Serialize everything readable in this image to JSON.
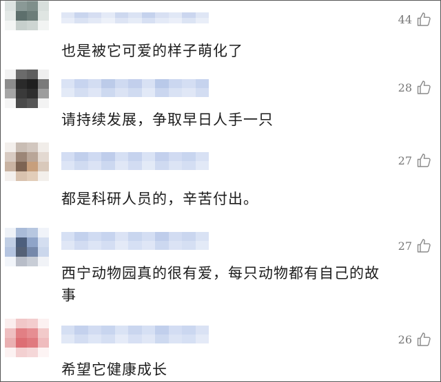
{
  "comments": [
    {
      "likes": "44",
      "text": "也是被它可爱的样子萌化了"
    },
    {
      "likes": "28",
      "text": "请持续发展，争取早日人手一只"
    },
    {
      "likes": "27",
      "text": "都是科研人员的，辛苦付出。"
    },
    {
      "likes": "27",
      "text": "西宁动物园真的很有爱，每只动物都有自己的故事"
    },
    {
      "likes": "26",
      "text": "希望它健康成长"
    }
  ],
  "icons": {
    "like": "thumbs-up-icon"
  },
  "colors": {
    "text": "#1c1c1c",
    "like_count": "#777777",
    "nickname_blur": "#c9d7f2"
  }
}
